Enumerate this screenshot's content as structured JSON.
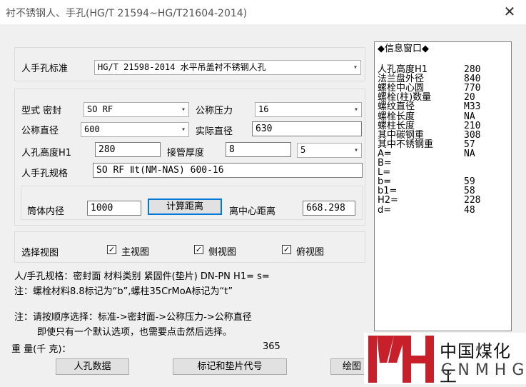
{
  "window": {
    "title": "衬不锈钢人、手孔(HG/T 21594~HG/T21604-2014)",
    "close": "✕"
  },
  "standard": {
    "label": "人手孔标准",
    "value": "HG/T 21598-2014 水平吊盖衬不锈钢人孔"
  },
  "form": {
    "type_seal_label": "型式 密封",
    "type_seal_value": "SO RF",
    "pressure_label": "公称压力",
    "pressure_value": "16",
    "diameter_label": "公称直径",
    "diameter_value": "600",
    "actual_diameter_label": "实际直径",
    "actual_diameter_value": "630",
    "height_label": "人孔高度H1",
    "height_value": "280",
    "pipe_thickness_label": "接管厚度",
    "pipe_thickness_value": "8",
    "pipe_thickness_select": "5",
    "spec_label": "人手孔规格",
    "spec_value": "SO RF Ⅱt(NM-NAS) 600-16"
  },
  "distance": {
    "inner_label": "筒体内径",
    "inner_value": "1000",
    "calc_button": "计算距离",
    "center_label": "离中心距离",
    "center_value": "668.298"
  },
  "views": {
    "label": "选择视图",
    "items": [
      {
        "label": "主视图",
        "checked": "✓"
      },
      {
        "label": "侧视图",
        "checked": "✓"
      },
      {
        "label": "俯视图",
        "checked": "✓"
      }
    ]
  },
  "notes": {
    "line1": "人/手孔规格：密封面 材料类别 紧固件(垫片) DN-PN H1= s=",
    "line2": "注：螺栓材料8.8标记为“b”,螺柱35CrMoA标记为“t”",
    "line3": "注：请按顺序选择：标准->密封面->公称压力->公称直径",
    "line4": "即使只有一个默认选项，也需要点击然后选择。"
  },
  "weight": {
    "label": "重    量(千  克)：",
    "value": "365"
  },
  "buttons": {
    "manhole_data": "人孔数据",
    "mark_gasket": "标记和垫片代号",
    "draw": "绘图"
  },
  "info": {
    "title": "◆信息窗口◆",
    "rows": [
      {
        "k": "人孔高度H1",
        "v": "280"
      },
      {
        "k": "法兰盘外径",
        "v": "840"
      },
      {
        "k": "螺栓中心圆",
        "v": "770"
      },
      {
        "k": "螺栓(柱)数量",
        "v": "20"
      },
      {
        "k": "螺纹直径",
        "v": "M33"
      },
      {
        "k": "螺栓长度",
        "v": "NA"
      },
      {
        "k": "螺柱长度",
        "v": "210"
      },
      {
        "k": "其中碳钢重",
        "v": "308"
      },
      {
        "k": "其中不锈钢重",
        "v": "57"
      },
      {
        "k": "A=",
        "v": "NA"
      },
      {
        "k": "B=",
        "v": ""
      },
      {
        "k": "L=",
        "v": ""
      },
      {
        "k": "b=",
        "v": "59"
      },
      {
        "k": "b1=",
        "v": "58"
      },
      {
        "k": "H2=",
        "v": "228"
      },
      {
        "k": "d=",
        "v": "48"
      }
    ]
  },
  "watermark": {
    "brand_cn": "中国煤化工",
    "brand_en": "CNMHG"
  },
  "colors": {
    "brand_red": "#c8202b",
    "focus_blue": "#0078d7"
  }
}
